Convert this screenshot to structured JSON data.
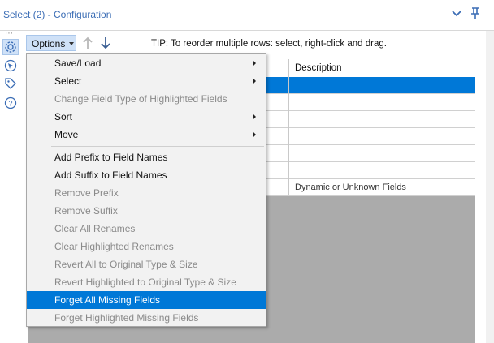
{
  "window": {
    "title": "Select (2) - Configuration",
    "icons": [
      "chevron-down-icon",
      "pin-icon"
    ]
  },
  "sidebar": {
    "icons": [
      "gear-icon",
      "cursor-icon",
      "tag-icon",
      "help-icon"
    ],
    "active": "gear-icon"
  },
  "toolbar": {
    "options_label": "Options",
    "tip": "TIP: To reorder multiple rows: select, right-click and drag.",
    "icons": [
      "move-up-arrow-icon",
      "move-down-arrow-icon"
    ]
  },
  "grid": {
    "headers": [
      "Description"
    ],
    "rows": [
      "",
      "",
      "",
      "",
      "",
      "",
      "Dynamic or Unknown Fields"
    ],
    "selected_row": 0
  },
  "menu": {
    "items": [
      {
        "label": "Save/Load",
        "submenu": true,
        "disabled": false
      },
      {
        "label": "Select",
        "submenu": true,
        "disabled": false
      },
      {
        "label": "Change Field Type of Highlighted Fields",
        "submenu": false,
        "disabled": true
      },
      {
        "label": "Sort",
        "submenu": true,
        "disabled": false
      },
      {
        "label": "Move",
        "submenu": true,
        "disabled": false
      },
      {
        "label": "Add Prefix to Field Names",
        "submenu": false,
        "disabled": false
      },
      {
        "label": "Add Suffix to Field Names",
        "submenu": false,
        "disabled": false
      },
      {
        "label": "Remove Prefix",
        "submenu": false,
        "disabled": true
      },
      {
        "label": "Remove Suffix",
        "submenu": false,
        "disabled": true
      },
      {
        "label": "Clear All Renames",
        "submenu": false,
        "disabled": true
      },
      {
        "label": "Clear Highlighted Renames",
        "submenu": false,
        "disabled": true
      },
      {
        "label": "Revert All to Original Type & Size",
        "submenu": false,
        "disabled": true
      },
      {
        "label": "Revert Highlighted to Original Type & Size",
        "submenu": false,
        "disabled": true
      },
      {
        "label": "Forget All Missing Fields",
        "submenu": false,
        "disabled": false,
        "highlighted": true
      },
      {
        "label": "Forget Highlighted Missing Fields",
        "submenu": false,
        "disabled": true
      }
    ]
  },
  "colors": {
    "accent": "#0078d7",
    "title_text": "#3b6db5",
    "button_bg": "#cfe1f7",
    "grid_empty": "#ababab"
  }
}
